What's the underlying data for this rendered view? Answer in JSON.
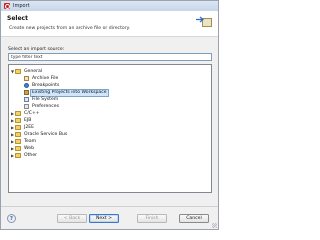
{
  "window": {
    "title": "Import",
    "app_icon": "eclipse-icon"
  },
  "header": {
    "title": "Select",
    "description": "Create new projects from an archive file or directory.",
    "image_icon": "import-wizard-icon"
  },
  "source": {
    "label": "Select an import source:",
    "filter_value": "type filter text"
  },
  "tree": {
    "items": [
      {
        "label": "General",
        "expanded": true,
        "type": "folder"
      },
      {
        "label": "Archive File",
        "type": "leaf",
        "icon": "archive-icon"
      },
      {
        "label": "Breakpoints",
        "type": "leaf",
        "icon": "breakpoint-icon"
      },
      {
        "label": "Existing Projects into Workspace",
        "type": "leaf",
        "icon": "project-icon",
        "selected": true
      },
      {
        "label": "File System",
        "type": "leaf",
        "icon": "filesystem-icon"
      },
      {
        "label": "Preferences",
        "type": "leaf",
        "icon": "preferences-icon"
      },
      {
        "label": "C/C++",
        "expanded": false,
        "type": "folder"
      },
      {
        "label": "EJB",
        "expanded": false,
        "type": "folder"
      },
      {
        "label": "J2EE",
        "expanded": false,
        "type": "folder"
      },
      {
        "label": "Oracle Service Bus",
        "expanded": false,
        "type": "folder"
      },
      {
        "label": "Team",
        "expanded": false,
        "type": "folder"
      },
      {
        "label": "Web",
        "expanded": false,
        "type": "folder"
      },
      {
        "label": "Other",
        "expanded": false,
        "type": "folder"
      }
    ]
  },
  "buttons": {
    "help": "?",
    "back": "< Back",
    "next": "Next >",
    "finish": "Finish",
    "cancel": "Cancel"
  },
  "colors": {
    "selection": "#cfe6fb",
    "title_bar": "#c7d6ea",
    "default_button_border": "#3a78c9"
  }
}
